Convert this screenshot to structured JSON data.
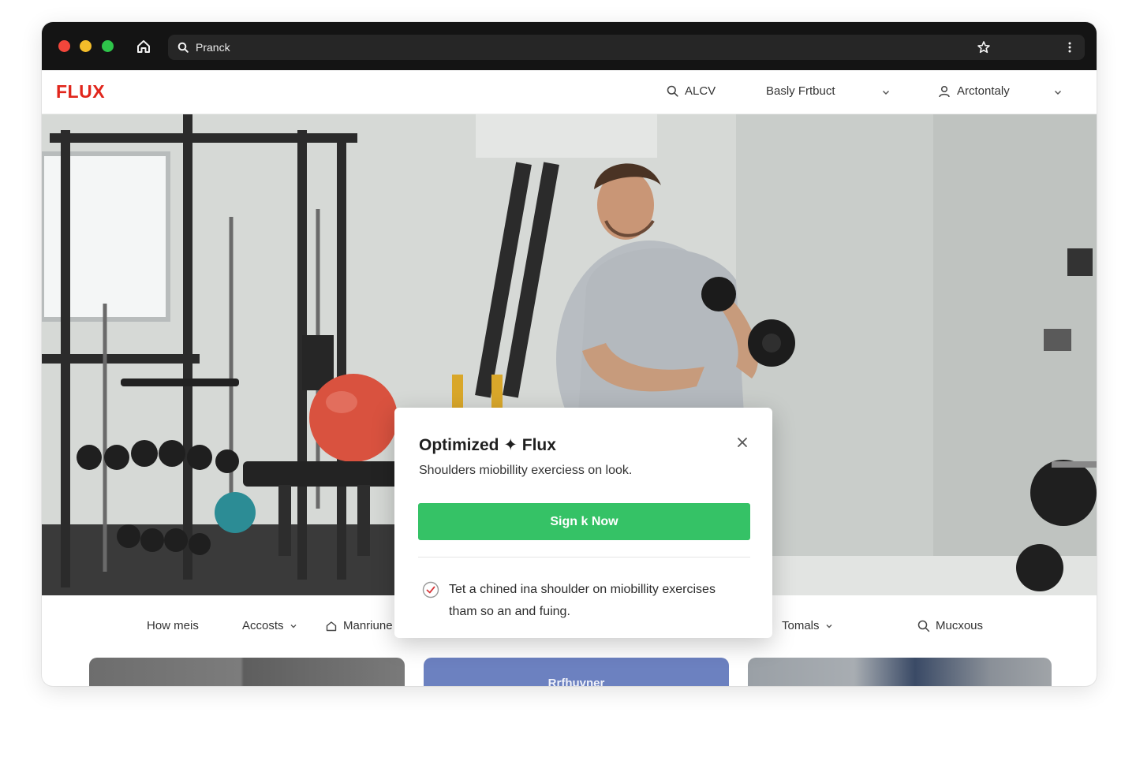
{
  "browser": {
    "address_text": "Pranck",
    "icons": [
      "home-icon",
      "search-icon",
      "star-icon",
      "kebab-menu-icon"
    ]
  },
  "header": {
    "logo": "FLUX",
    "search_label": "ALCV",
    "product_menu_label": "Basly Frtbuct",
    "account_menu_label": "Arctontaly"
  },
  "subnav": {
    "items": [
      {
        "label": "How meis"
      },
      {
        "label": "Accosts"
      },
      {
        "label": "Manriune"
      },
      {
        "label": "Tomals"
      },
      {
        "label": "Mucxous"
      }
    ]
  },
  "cards": {
    "middle_label": "Rrfhuvner"
  },
  "modal": {
    "title": "Optimized ✦ Flux",
    "subtitle": "Shoulders miobillity exerciess on look.",
    "cta_label": "Sign k Now",
    "note": "Tet a chined ina shoulder on miobillity exercises tham so an and fuing."
  },
  "colors": {
    "brand": "#e1261c",
    "cta": "#35c266",
    "chrome": "#141414"
  }
}
